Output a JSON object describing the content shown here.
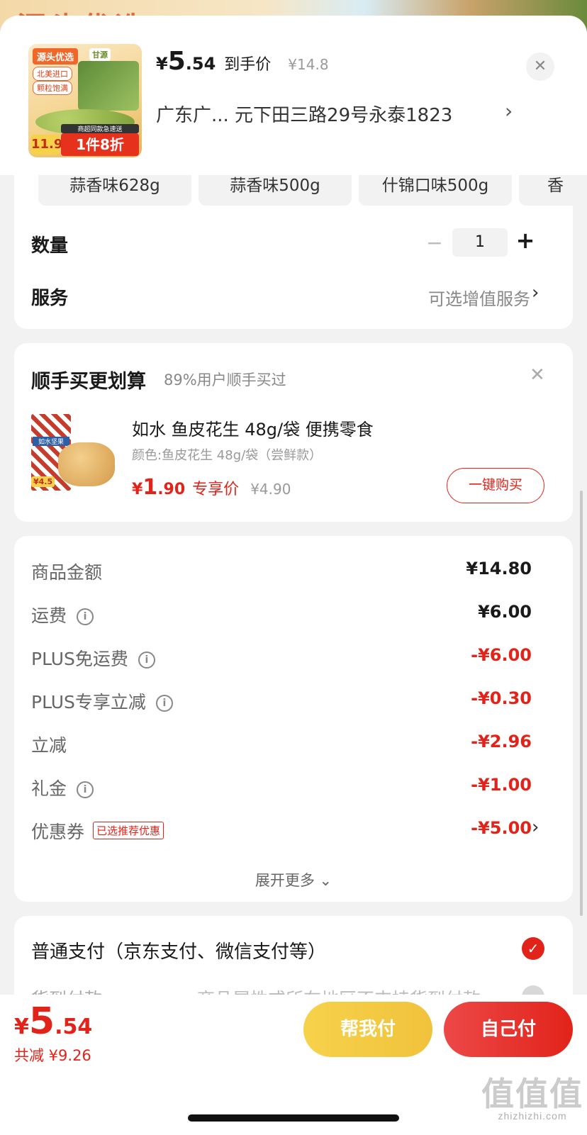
{
  "backdrop": {
    "text": "源头优选"
  },
  "header": {
    "thumb": {
      "badge": "源头优选",
      "tag1": "北美进口",
      "tag2": "颗粒饱满",
      "brand": "甘源",
      "price": "11.9",
      "discount_sub": "商超同款急速送",
      "discount": "1件8折"
    },
    "price_yen": "¥",
    "price_int": "5",
    "price_dec": ".54",
    "price_label": "到手价",
    "original_price": "¥14.8",
    "address": "广东广...  元下田三路29号永泰1823",
    "close_icon": "✕",
    "chevron": "›"
  },
  "spec": {
    "chips": [
      "蒜香味628g",
      "蒜香味500g",
      "什锦口味500g",
      "香"
    ],
    "quantity_label": "数量",
    "quantity_minus": "−",
    "quantity_value": "1",
    "quantity_plus": "+",
    "service_label": "服务",
    "service_value": "可选增值服务",
    "chevron": "›"
  },
  "bundle": {
    "title": "顺手买更划算",
    "subtitle": "89%用户顺手买过",
    "close_icon": "✕",
    "img_label": "如水坚果",
    "img_price": "¥4.5",
    "name": "如水 鱼皮花生 48g/袋 便携零食",
    "color": "颜色:鱼皮花生 48g/袋（尝鲜款）",
    "price_yen": "¥",
    "price_int": "1",
    "price_dec": ".90",
    "price_label": "专享价",
    "original_price": "¥4.90",
    "buy_label": "一键购买"
  },
  "details": {
    "rows": [
      {
        "label": "商品金额",
        "value": "¥14.80",
        "info": false,
        "red": false
      },
      {
        "label": "运费",
        "value": "¥6.00",
        "info": true,
        "red": false
      },
      {
        "label": "PLUS免运费",
        "value": "-¥6.00",
        "info": true,
        "red": true
      },
      {
        "label": "PLUS专享立减",
        "value": "-¥0.30",
        "info": true,
        "red": true
      },
      {
        "label": "立减",
        "value": "-¥2.96",
        "info": false,
        "red": true
      },
      {
        "label": "礼金",
        "value": "-¥1.00",
        "info": true,
        "red": true
      },
      {
        "label": "优惠券",
        "value": "-¥5.00",
        "info": false,
        "red": true,
        "tag": "已选推荐优惠",
        "chevron": "›"
      }
    ],
    "info_icon": "i",
    "expand_label": "展开更多 ⌄"
  },
  "payment": {
    "normal_label": "普通支付（京东支付、微信支付等）",
    "check_icon": "✓",
    "cod_label": "货到付款",
    "cod_note": "商品属性或所在地区不支持货到付款"
  },
  "bottom": {
    "price_yen": "¥",
    "price_int": "5",
    "price_dec": ".54",
    "saved": "共减 ¥9.26",
    "help_pay": "帮我付",
    "self_pay": "自己付"
  },
  "watermark": {
    "big": "值值值",
    "small": "zhizhizhi.com"
  },
  "colors": {
    "accent": "#e2231a",
    "help_button": "#f3c83f",
    "background": "#f2f2f2"
  }
}
